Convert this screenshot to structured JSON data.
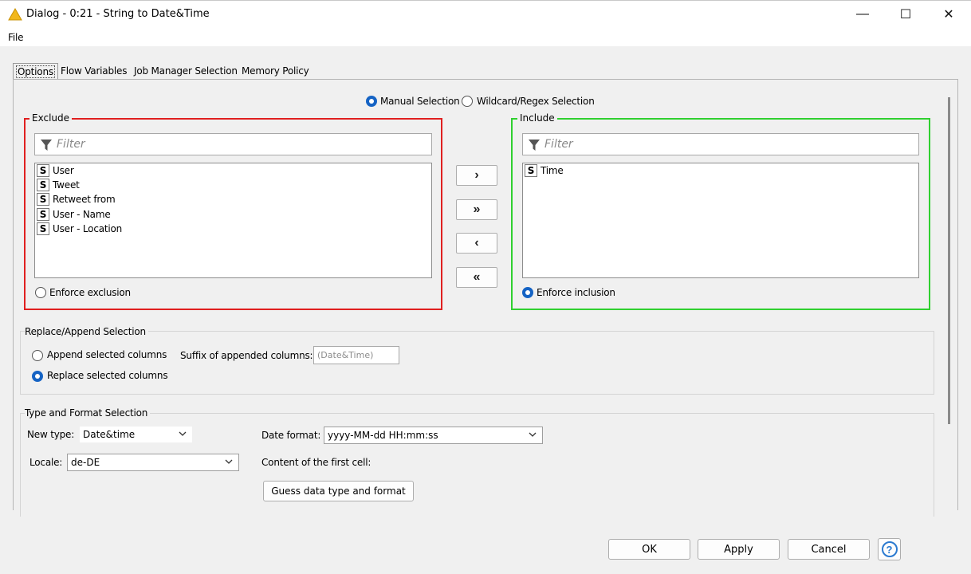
{
  "window": {
    "title": "Dialog - 0:21 - String to Date&Time",
    "minimize_glyph": "—",
    "maximize_glyph": "☐",
    "close_glyph": "✕"
  },
  "menu": {
    "file": "File"
  },
  "tabs": [
    {
      "label": "Options",
      "active": true
    },
    {
      "label": "Flow Variables"
    },
    {
      "label": "Job Manager Selection"
    },
    {
      "label": "Memory Policy"
    }
  ],
  "selection_mode": {
    "manual": "Manual Selection",
    "wildcard": "Wildcard/Regex Selection",
    "selected": "manual"
  },
  "exclude": {
    "title": "Exclude",
    "filter_placeholder": "Filter",
    "items": [
      {
        "type": "S",
        "name": "User"
      },
      {
        "type": "S",
        "name": "Tweet"
      },
      {
        "type": "S",
        "name": "Retweet from"
      },
      {
        "type": "S",
        "name": "User - Name"
      },
      {
        "type": "S",
        "name": "User - Location"
      }
    ],
    "enforce_label": "Enforce exclusion"
  },
  "include": {
    "title": "Include",
    "filter_placeholder": "Filter",
    "items": [
      {
        "type": "S",
        "name": "Time"
      }
    ],
    "enforce_label": "Enforce inclusion"
  },
  "move_buttons": {
    "add": "›",
    "add_all": "»",
    "remove": "‹",
    "remove_all": "«"
  },
  "replace_append": {
    "title": "Replace/Append Selection",
    "append_label": "Append selected columns",
    "replace_label": "Replace selected columns",
    "selected": "replace",
    "suffix_label": "Suffix of appended columns:",
    "suffix_value": "(Date&Time)"
  },
  "type_format": {
    "title": "Type and Format Selection",
    "new_type_label": "New type:",
    "new_type_value": "Date&time",
    "date_format_label": "Date format:",
    "date_format_value": "yyyy-MM-dd HH:mm:ss",
    "locale_label": "Locale:",
    "locale_value": "de-DE",
    "first_cell_label": "Content of the first cell:",
    "guess_button": "Guess data type and format"
  },
  "footer": {
    "ok": "OK",
    "apply": "Apply",
    "cancel": "Cancel",
    "help": "?"
  },
  "colors": {
    "exclude_border": "#e02020",
    "include_border": "#30d030",
    "radio_accent": "#1563c4",
    "help_accent": "#2b7ad0"
  }
}
